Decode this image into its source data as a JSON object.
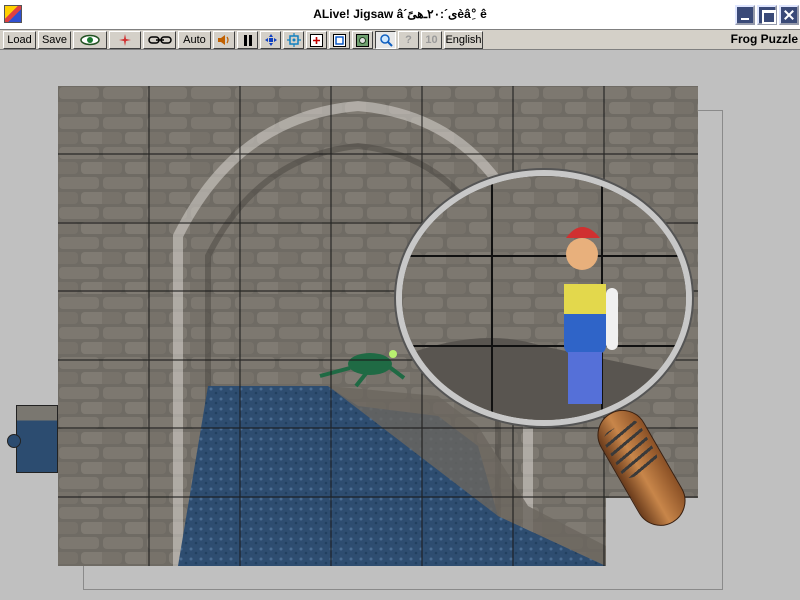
{
  "window": {
    "title": "ALive! Jigsaw  â´ى´:٢٠ـ​ﻫﯽًèâ°ِ ê"
  },
  "toolbar": {
    "load_label": "Load",
    "save_label": "Save",
    "auto_label": "Auto",
    "help_label": "?",
    "count_label": "10",
    "language_label": "English",
    "puzzle_name": "Frog Puzzle"
  },
  "icons": {
    "app": "puzzle-app-icon",
    "eye": "eye-icon",
    "sparkle": "sparkle-icon",
    "link": "chain-link-icon",
    "sound": "speaker-icon",
    "pause": "pause-icon",
    "move": "move-icon",
    "center": "center-icon",
    "zoom_in": "zoom-in-icon",
    "zoom_out": "zoom-out-icon",
    "preview": "preview-image-icon",
    "magnifier": "magnifier-icon"
  },
  "colors": {
    "toolbar_bg": "#d4d0c8",
    "window_btn": "#3a4a78",
    "board_bg": "#6e6a63",
    "water": "#2c4c70"
  }
}
